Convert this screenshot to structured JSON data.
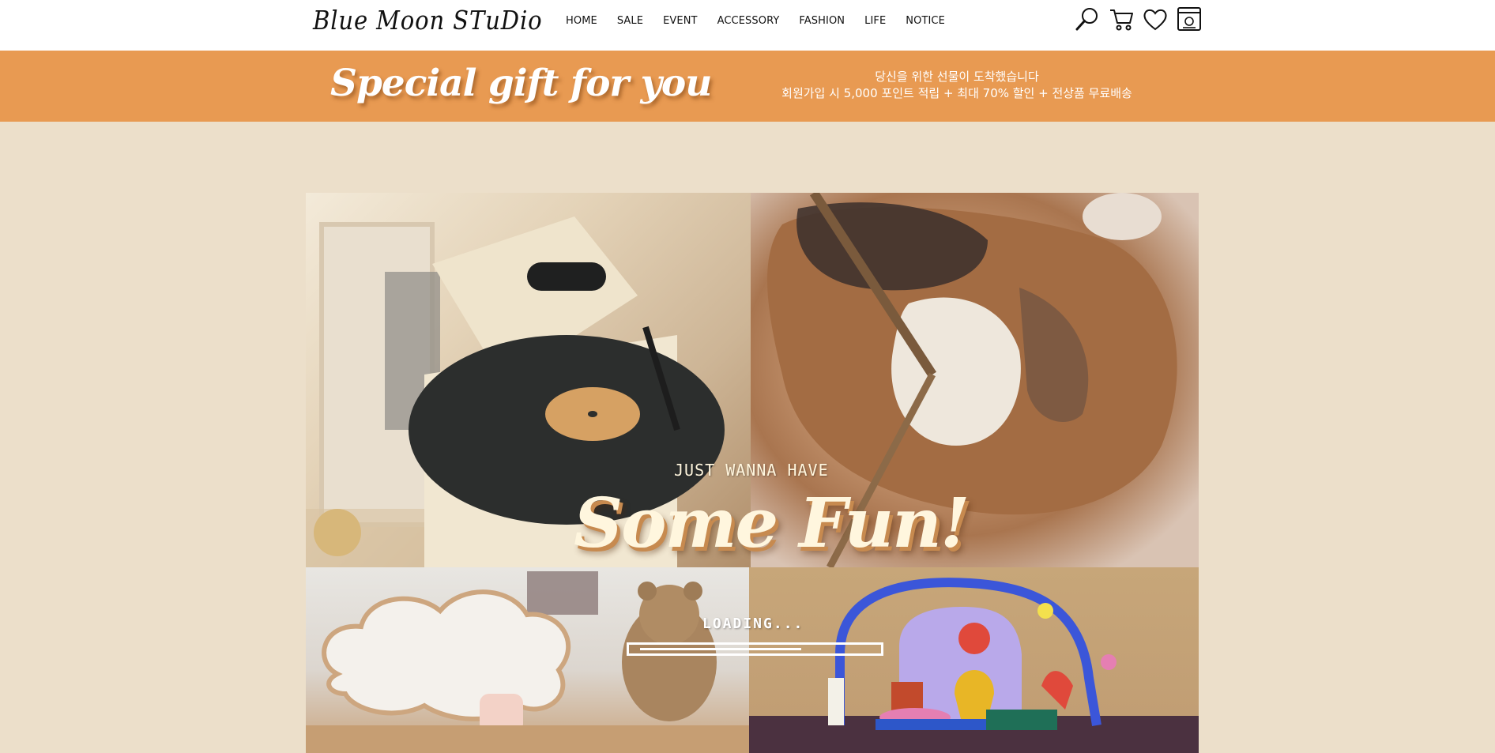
{
  "header": {
    "logo": "Blue Moon STuDio",
    "nav": [
      "HOME",
      "SALE",
      "EVENT",
      "ACCESSORY",
      "FASHION",
      "LIFE",
      "NOTICE"
    ],
    "icons": [
      "search-icon",
      "cart-icon",
      "heart-icon",
      "mypage-icon"
    ]
  },
  "banner": {
    "title": "Special gift for you",
    "line1": "당신을 위한 선물이 도착했습니다",
    "line2": "회원가입 시 5,000 포인트 적립 + 최대 70% 할인 + 전상품 무료배송",
    "color": "#e89a52"
  },
  "hero": {
    "subtitle": "JUST WANNA HAVE",
    "title": "Some Fun!",
    "loading_label": "LOADING...",
    "progress": 0.7
  },
  "colors": {
    "background": "#ecdfca",
    "accent": "#e89a52"
  }
}
